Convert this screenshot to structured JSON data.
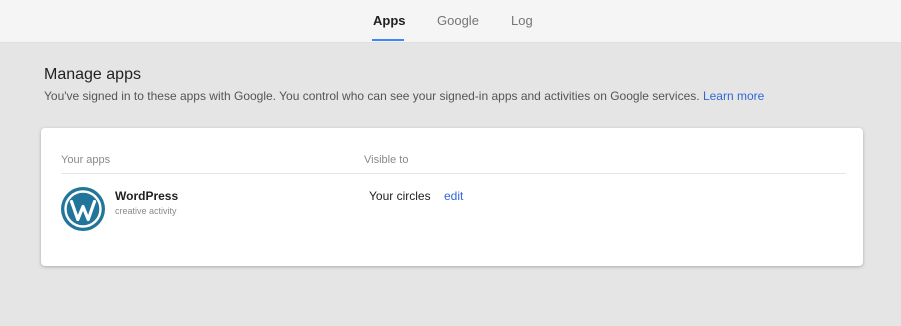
{
  "tabs": [
    {
      "label": "Apps",
      "active": true
    },
    {
      "label": "Google",
      "active": false
    },
    {
      "label": "Log",
      "active": false
    }
  ],
  "colors": {
    "accent": "#4285f4",
    "link": "#3367d6",
    "background": "#e5e5e5",
    "card": "#ffffff",
    "wordpress": "#21759b"
  },
  "section": {
    "title": "Manage apps",
    "description": "You've signed in to these apps with Google. You control who can see your signed-in apps and activities on Google services.",
    "learn_more": "Learn more"
  },
  "table": {
    "col_apps": "Your apps",
    "col_visible": "Visible to",
    "rows": [
      {
        "icon": "wordpress-logo-icon",
        "name": "WordPress",
        "subtitle": "creative activity",
        "visible_to": "Your circles",
        "action": "edit"
      }
    ]
  }
}
